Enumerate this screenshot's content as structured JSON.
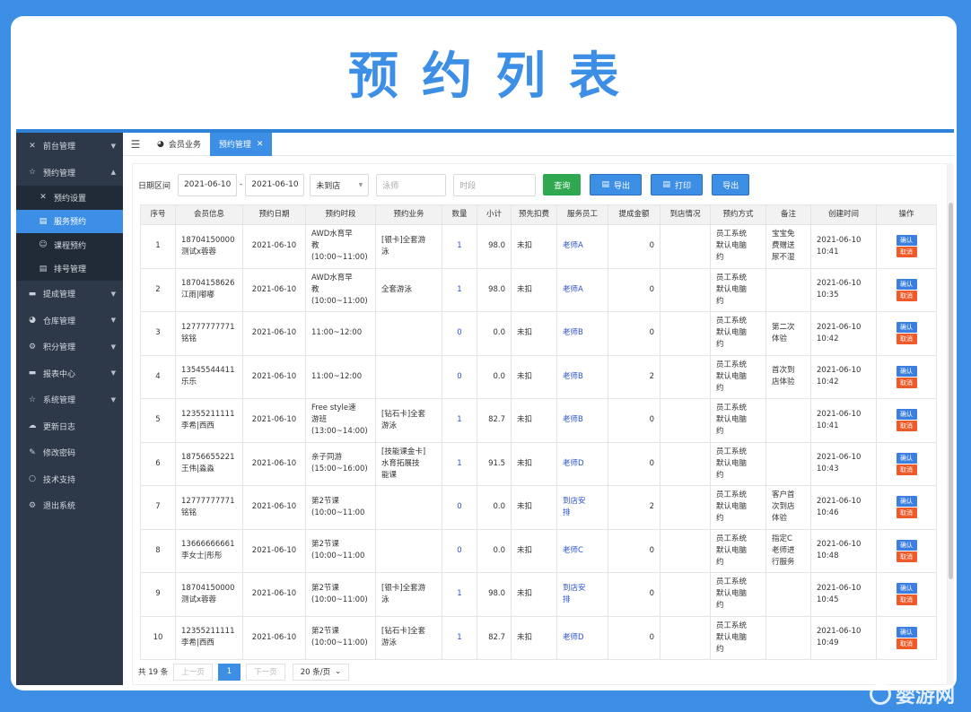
{
  "banner": {
    "title": "预约列表"
  },
  "sidebar": {
    "items": [
      {
        "label": "前台管理",
        "icon": "shuffle-icon",
        "glyph": "✕",
        "arrow": "▼"
      },
      {
        "label": "预约管理",
        "icon": "star-icon",
        "glyph": "☆",
        "arrow": "▲"
      },
      {
        "label": "提成管理",
        "icon": "comment-icon",
        "glyph": "▬",
        "arrow": "▼"
      },
      {
        "label": "仓库管理",
        "icon": "dashboard-icon",
        "glyph": "◕",
        "arrow": "▼"
      },
      {
        "label": "积分管理",
        "icon": "settings-icon",
        "glyph": "⚙",
        "arrow": "▼"
      },
      {
        "label": "报表中心",
        "icon": "comment-icon",
        "glyph": "▬",
        "arrow": "▼"
      },
      {
        "label": "系统管理",
        "icon": "star-icon",
        "glyph": "☆",
        "arrow": "▼"
      },
      {
        "label": "更新日志",
        "icon": "cloud-icon",
        "glyph": "☁",
        "arrow": ""
      },
      {
        "label": "修改密码",
        "icon": "edit-icon",
        "glyph": "✎",
        "arrow": ""
      },
      {
        "label": "技术支持",
        "icon": "help-icon",
        "glyph": "○",
        "arrow": ""
      },
      {
        "label": "退出系统",
        "icon": "gears-icon",
        "glyph": "⚙",
        "arrow": ""
      }
    ],
    "sub": [
      {
        "label": "预约设置",
        "icon": "shuffle-icon",
        "glyph": "✕"
      },
      {
        "label": "服务预约",
        "icon": "clipboard-icon",
        "glyph": "▤"
      },
      {
        "label": "课程预约",
        "icon": "smile-icon",
        "glyph": "☺"
      },
      {
        "label": "排号管理",
        "icon": "clipboard-icon",
        "glyph": "▤"
      }
    ]
  },
  "topbar": {
    "toggle_glyph": "☰",
    "tabs": [
      {
        "label": "会员业务",
        "icon": "dashboard-icon",
        "glyph": "◕"
      },
      {
        "label": "预约管理",
        "close": "✕"
      }
    ]
  },
  "filters": {
    "date_label": "日期区间",
    "date_from": "2021-06-10",
    "dash": "-",
    "date_to": "2021-06-10",
    "status_value": "未到店",
    "status_arrow": "▼",
    "swimmer_placeholder": "泳师",
    "timeslot_placeholder": "时段",
    "query_label": "查询",
    "export1_label": "导出",
    "print_label": "打印",
    "export2_label": "导出"
  },
  "table": {
    "headers": [
      "序号",
      "会员信息",
      "预约日期",
      "预约时段",
      "预约业务",
      "数量",
      "小计",
      "预先扣费",
      "服务员工",
      "提成金额",
      "到店情况",
      "预约方式",
      "备注",
      "创建时间",
      "操作"
    ],
    "confirm_label": "确认",
    "cancel_label": "取消",
    "rows": [
      {
        "no": "1",
        "member": "18704150000\n测试x蓉蓉",
        "date": "2021-06-10",
        "slot": "AWD水育早\n教\n(10:00~11:00)",
        "service": "[银卡]全套游\n泳",
        "qty": "1",
        "subtotal": "98.0",
        "prepaid": "未扣",
        "staff": "老师A",
        "commission": "0",
        "arrival": "",
        "method": "员工系统\n默认电脑\n约",
        "note": "宝宝免\n费赠送\n尿不湿",
        "created": "2021-06-10\n10:41"
      },
      {
        "no": "2",
        "member": "18704158626\n江雨|嘟嘟",
        "date": "2021-06-10",
        "slot": "AWD水育早\n教\n(10:00~11:00)",
        "service": "全套游泳",
        "qty": "1",
        "subtotal": "98.0",
        "prepaid": "未扣",
        "staff": "老师A",
        "commission": "0",
        "arrival": "",
        "method": "员工系统\n默认电脑\n约",
        "note": "",
        "created": "2021-06-10\n10:35"
      },
      {
        "no": "3",
        "member": "12777777771\n铭铭",
        "date": "2021-06-10",
        "slot": "11:00~12:00",
        "service": "",
        "qty": "0",
        "subtotal": "0.0",
        "prepaid": "未扣",
        "staff": "老师B",
        "commission": "0",
        "arrival": "",
        "method": "员工系统\n默认电脑\n约",
        "note": "第二次\n体验",
        "created": "2021-06-10\n10:42"
      },
      {
        "no": "4",
        "member": "13545544411\n乐乐",
        "date": "2021-06-10",
        "slot": "11:00~12:00",
        "service": "",
        "qty": "0",
        "subtotal": "0.0",
        "prepaid": "未扣",
        "staff": "老师B",
        "commission": "2",
        "arrival": "",
        "method": "员工系统\n默认电脑\n约",
        "note": "首次到\n店体验",
        "created": "2021-06-10\n10:42"
      },
      {
        "no": "5",
        "member": "12355211111\n李希|西西",
        "date": "2021-06-10",
        "slot": "Free style速\n游班\n(13:00~14:00)",
        "service": "[钻石卡]全套\n游泳",
        "qty": "1",
        "subtotal": "82.7",
        "prepaid": "未扣",
        "staff": "老师B",
        "commission": "0",
        "arrival": "",
        "method": "员工系统\n默认电脑\n约",
        "note": "",
        "created": "2021-06-10\n10:41"
      },
      {
        "no": "6",
        "member": "18756655221\n王伟|淼淼",
        "date": "2021-06-10",
        "slot": "亲子同游\n(15:00~16:00)",
        "service": "[技能课金卡]\n水育拓展技\n能课",
        "qty": "1",
        "subtotal": "91.5",
        "prepaid": "未扣",
        "staff": "老师D",
        "commission": "0",
        "arrival": "",
        "method": "员工系统\n默认电脑\n约",
        "note": "",
        "created": "2021-06-10\n10:43"
      },
      {
        "no": "7",
        "member": "12777777771\n铭铭",
        "date": "2021-06-10",
        "slot": "第2节课\n(10:00~11:00",
        "service": "",
        "qty": "0",
        "subtotal": "0.0",
        "prepaid": "未扣",
        "staff": "到店安\n排",
        "commission": "2",
        "arrival": "",
        "method": "员工系统\n默认电脑\n约",
        "note": "客户首\n次到店\n体验",
        "created": "2021-06-10\n10:46"
      },
      {
        "no": "8",
        "member": "13666666661\n李女士|彤彤",
        "date": "2021-06-10",
        "slot": "第2节课\n(10:00~11:00",
        "service": "",
        "qty": "0",
        "subtotal": "0.0",
        "prepaid": "未扣",
        "staff": "老师C",
        "commission": "0",
        "arrival": "",
        "method": "员工系统\n默认电脑\n约",
        "note": "指定C\n老师进\n行服务",
        "created": "2021-06-10\n10:48"
      },
      {
        "no": "9",
        "member": "18704150000\n测试x蓉蓉",
        "date": "2021-06-10",
        "slot": "第2节课\n(10:00~11:00)",
        "service": "[银卡]全套游\n泳",
        "qty": "1",
        "subtotal": "98.0",
        "prepaid": "未扣",
        "staff": "到店安\n排",
        "commission": "0",
        "arrival": "",
        "method": "员工系统\n默认电脑\n约",
        "note": "",
        "created": "2021-06-10\n10:45"
      },
      {
        "no": "10",
        "member": "12355211111\n李希|西西",
        "date": "2021-06-10",
        "slot": "第2节课\n(10:00~11:00)",
        "service": "[钻石卡]全套\n游泳",
        "qty": "1",
        "subtotal": "82.7",
        "prepaid": "未扣",
        "staff": "老师D",
        "commission": "0",
        "arrival": "",
        "method": "员工系统\n默认电脑\n约",
        "note": "",
        "created": "2021-06-10\n10:49"
      }
    ]
  },
  "pager": {
    "total": "共 19 条",
    "prev": "上一页",
    "current": "1",
    "next": "下一页",
    "size": "20 条/页",
    "size_arrow": "⌄"
  },
  "watermark": {
    "text": "婴游网"
  },
  "colors": {
    "brand": "#3d8fe6",
    "sidebar": "#2d3949",
    "confirm": "#3d7fe0",
    "cancel": "#f05a28",
    "query": "#2fa84f"
  }
}
